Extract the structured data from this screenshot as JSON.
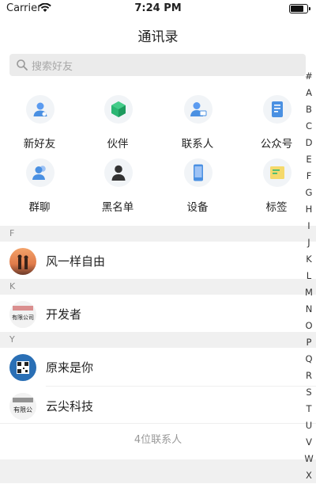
{
  "status": {
    "carrier": "Carrier",
    "time": "7:24 PM"
  },
  "nav": {
    "title": "通讯录"
  },
  "search": {
    "placeholder": "搜索好友"
  },
  "functions": [
    {
      "label": "新好友",
      "icon": "new-friend-icon"
    },
    {
      "label": "伙伴",
      "icon": "partner-icon"
    },
    {
      "label": "联系人",
      "icon": "contacts-icon"
    },
    {
      "label": "公众号",
      "icon": "official-account-icon"
    },
    {
      "label": "群聊",
      "icon": "group-chat-icon"
    },
    {
      "label": "黑名单",
      "icon": "blacklist-icon"
    },
    {
      "label": "设备",
      "icon": "device-icon"
    },
    {
      "label": "标签",
      "icon": "tag-icon"
    }
  ],
  "sections": [
    {
      "letter": "F",
      "contacts": [
        {
          "name": "风一样自由"
        }
      ]
    },
    {
      "letter": "K",
      "contacts": [
        {
          "name": "开发者",
          "avatar_text": "有限公司"
        }
      ]
    },
    {
      "letter": "Y",
      "contacts": [
        {
          "name": "原来是你"
        },
        {
          "name": "云尖科技",
          "avatar_text": "有限公"
        }
      ]
    }
  ],
  "footer": "4位联系人",
  "index": [
    "#",
    "A",
    "B",
    "C",
    "D",
    "E",
    "F",
    "G",
    "H",
    "I",
    "J",
    "K",
    "L",
    "M",
    "N",
    "O",
    "P",
    "Q",
    "R",
    "S",
    "T",
    "U",
    "V",
    "W",
    "X"
  ],
  "colors": {
    "accent": "#4a90e2",
    "green": "#2bb673",
    "section_bg": "#f0f0f0"
  }
}
